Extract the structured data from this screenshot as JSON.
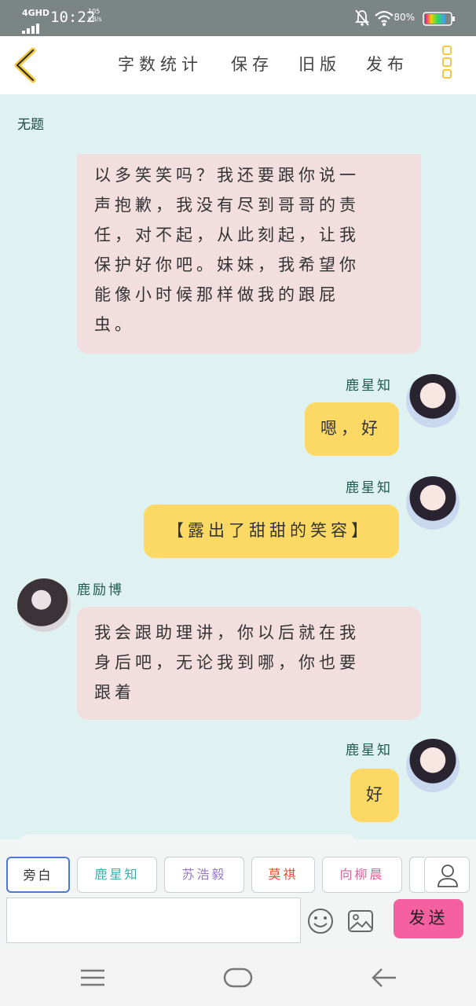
{
  "status_bar": {
    "network": "4GHD",
    "time": "10:22",
    "speed_value": "105",
    "speed_unit": "KB/s",
    "battery": "80%"
  },
  "toolbar": {
    "word_count": "字数统计",
    "save": "保存",
    "old_version": "旧版",
    "publish": "发布"
  },
  "document": {
    "title": "无题"
  },
  "messages": [
    {
      "text_lines": [
        "以多笑笑吗？我还要跟你说一",
        "声抱歉，我没有尽到哥哥的责",
        "任，对不起，从此刻起，让我",
        "保护好你吧。妹妹，我希望你",
        "能像小时候那样做我的跟屁",
        "虫。"
      ]
    },
    {
      "sender": "鹿星知",
      "text": "嗯，好"
    },
    {
      "sender": "鹿星知",
      "text": "【露出了甜甜的笑容】"
    },
    {
      "sender": "鹿励博",
      "text_lines": [
        "我会跟助理讲，你以后就在我",
        "身后吧，无论我到哪，你也要",
        "跟着"
      ]
    },
    {
      "sender": "鹿星知",
      "text": "好"
    }
  ],
  "role_chips": [
    {
      "label": "旁白",
      "color": "#333333"
    },
    {
      "label": "鹿星知",
      "color": "#3ab0a8"
    },
    {
      "label": "苏浩毅",
      "color": "#9a78c8"
    },
    {
      "label": "莫祺",
      "color": "#e0503a"
    },
    {
      "label": "向柳晨",
      "color": "#e0609a"
    }
  ],
  "composer": {
    "input_value": "",
    "send_label": "发送"
  },
  "colors": {
    "background": "#dff2f1",
    "pink_bubble": "#f2dddf",
    "yellow_bubble": "#fbd964",
    "send_button": "#f560a0",
    "accent_yellow": "#f2c840"
  }
}
